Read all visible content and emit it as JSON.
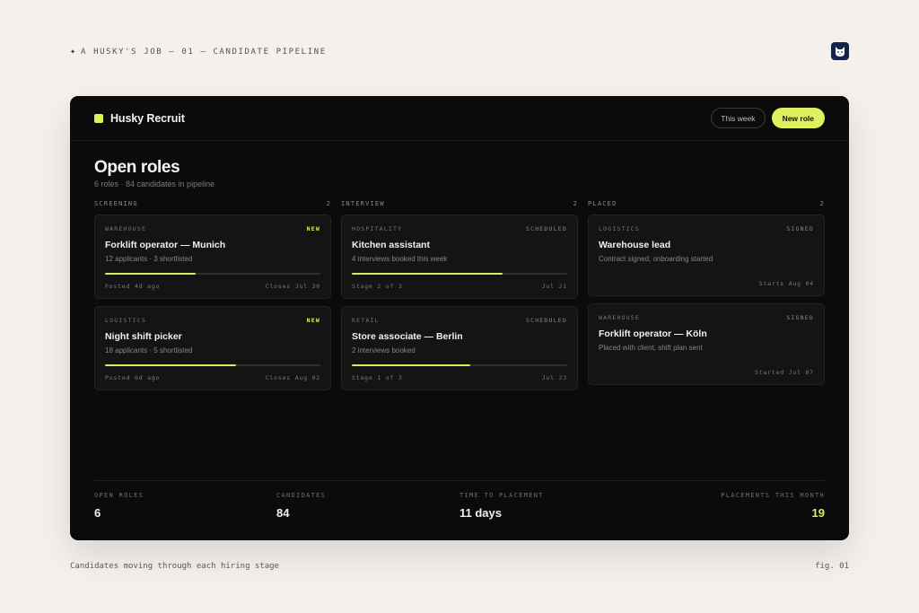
{
  "caption": {
    "top": "A HUSKY'S JOB — 01 — CANDIDATE PIPELINE",
    "bottom": "Candidates moving through each hiring stage",
    "fig": "fig. 01"
  },
  "icons": {
    "sparkle": "sparkle-icon",
    "logo": "husky-logo-icon"
  },
  "colors": {
    "accent": "#dff25c",
    "app_bg": "#0b0b0b",
    "card_bg": "#141414",
    "page_bg": "#f4f1ec",
    "logo_bg": "#13234a"
  },
  "header": {
    "brand": "Husky Recruit",
    "this_week": "This week",
    "new_role": "New role"
  },
  "page": {
    "title": "Open roles",
    "subtitle": "6 roles · 84 candidates in pipeline"
  },
  "columns": [
    {
      "name": "SCREENING",
      "count": "2",
      "cards": [
        {
          "category": "WAREHOUSE",
          "badge": "NEW",
          "title": "Forklift operator — Munich",
          "desc": "12 applicants · 3 shortlisted",
          "progress": 0.42,
          "left": "Posted 4d ago",
          "right": "Closes Jul 30"
        },
        {
          "category": "LOGISTICS",
          "badge": "NEW",
          "title": "Night shift picker",
          "desc": "18 applicants · 5 shortlisted",
          "progress": 0.61,
          "left": "Posted 6d ago",
          "right": "Closes Aug 02"
        }
      ]
    },
    {
      "name": "INTERVIEW",
      "count": "2",
      "cards": [
        {
          "category": "HOSPITALITY",
          "badge": "SCHEDULED",
          "title": "Kitchen assistant",
          "desc": "4 interviews booked this week",
          "progress": 0.7,
          "left": "Stage 2 of 3",
          "right": "Jul 21"
        },
        {
          "category": "RETAIL",
          "badge": "SCHEDULED",
          "title": "Store associate — Berlin",
          "desc": "2 interviews booked",
          "progress": 0.55,
          "left": "Stage 1 of 3",
          "right": "Jul 23"
        }
      ]
    },
    {
      "name": "PLACED",
      "count": "2",
      "cards": [
        {
          "category": "LOGISTICS",
          "badge": "SIGNED",
          "title": "Warehouse lead",
          "desc": "Contract signed, onboarding started",
          "right": "Starts Aug 04"
        },
        {
          "category": "WAREHOUSE",
          "badge": "SIGNED",
          "title": "Forklift operator — Köln",
          "desc": "Placed with client, shift plan sent",
          "right": "Started Jul 07"
        }
      ]
    }
  ],
  "stats": [
    {
      "label": "OPEN ROLES",
      "value": "6"
    },
    {
      "label": "CANDIDATES",
      "value": "84"
    },
    {
      "label": "TIME TO PLACEMENT",
      "value": "11 days"
    },
    {
      "label": "PLACEMENTS THIS MONTH",
      "value": "19"
    }
  ]
}
